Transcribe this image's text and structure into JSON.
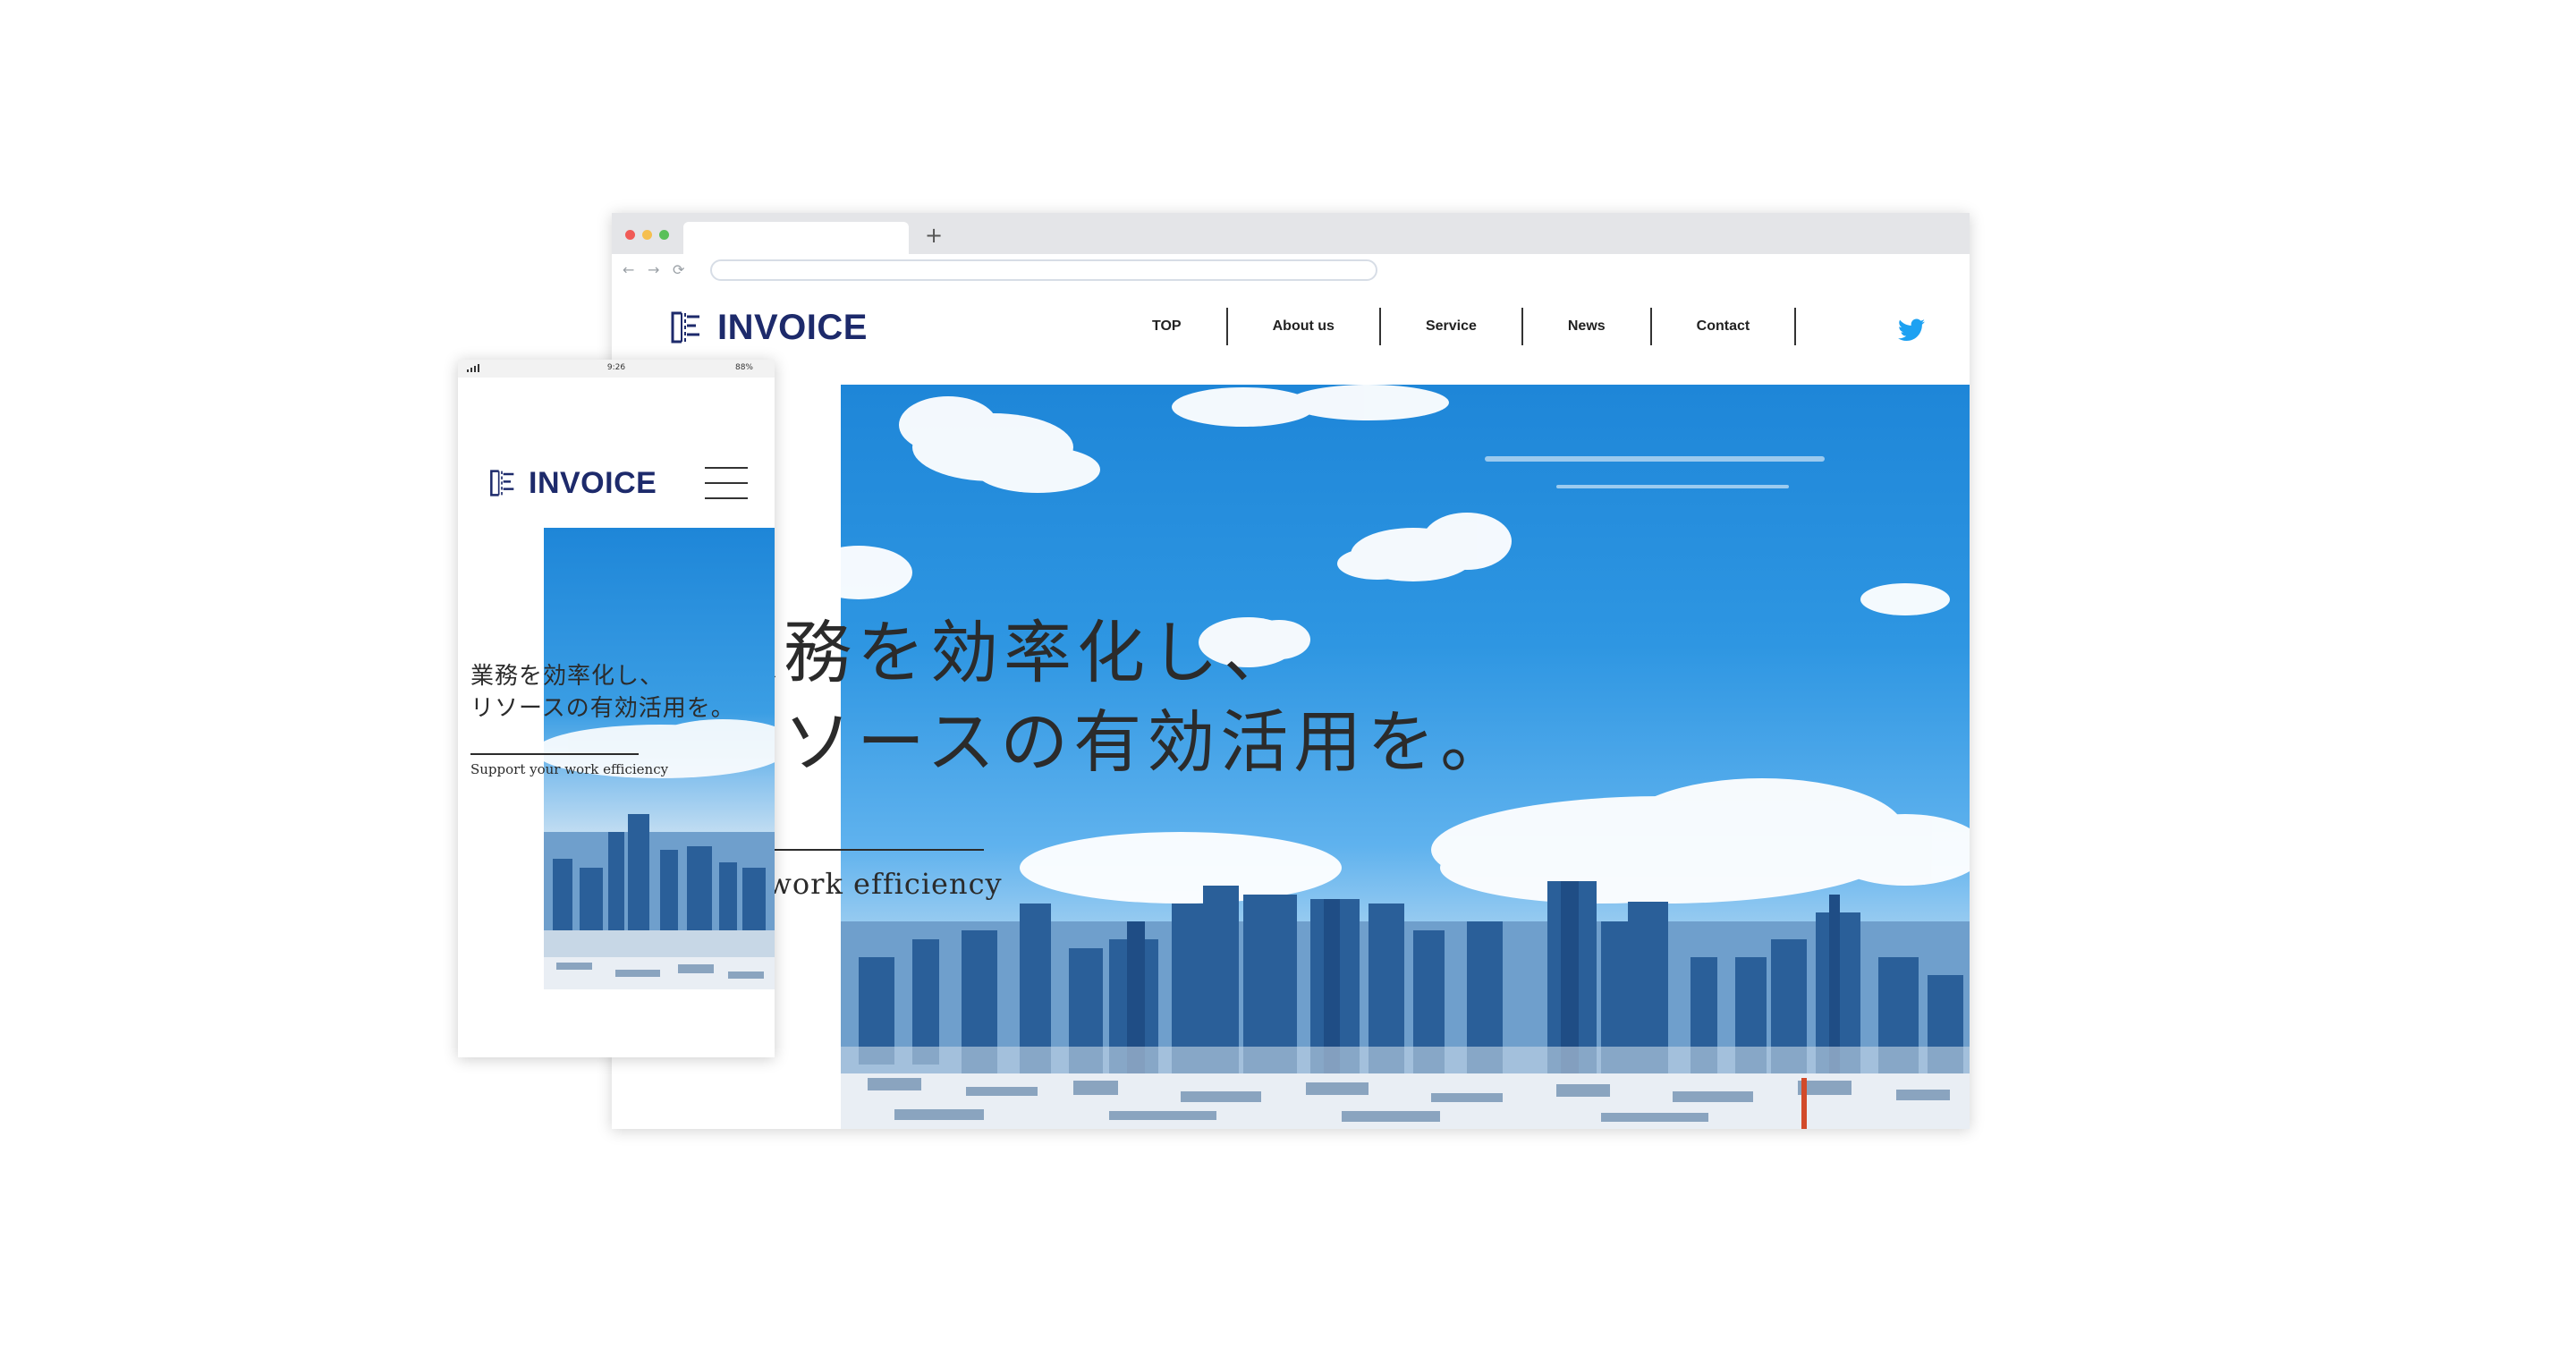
{
  "brand": {
    "name": "INVOICE",
    "logo_color": "#1d2a6b"
  },
  "desktop": {
    "browser": {
      "new_tab_symbol": "+",
      "back_icon": "←",
      "forward_icon": "→",
      "reload_icon": "⟳"
    },
    "nav": {
      "items": [
        {
          "label": "TOP"
        },
        {
          "label": "About us"
        },
        {
          "label": "Service"
        },
        {
          "label": "News"
        },
        {
          "label": "Contact"
        }
      ],
      "social_icon": "twitter-icon",
      "social_color": "#1da1f2"
    },
    "hero": {
      "headline_line1": "業務を効率化し、",
      "headline_line2": "リソースの有効活用を。",
      "subline": "Support your work efficiency"
    }
  },
  "mobile": {
    "status": {
      "time": "9:26",
      "battery": "88%"
    },
    "menu_icon": "hamburger-menu-icon",
    "hero": {
      "headline_line1": "業務を効率化し、",
      "headline_line2": "リソースの有効活用を。",
      "subline": "Support your work efficiency"
    }
  }
}
